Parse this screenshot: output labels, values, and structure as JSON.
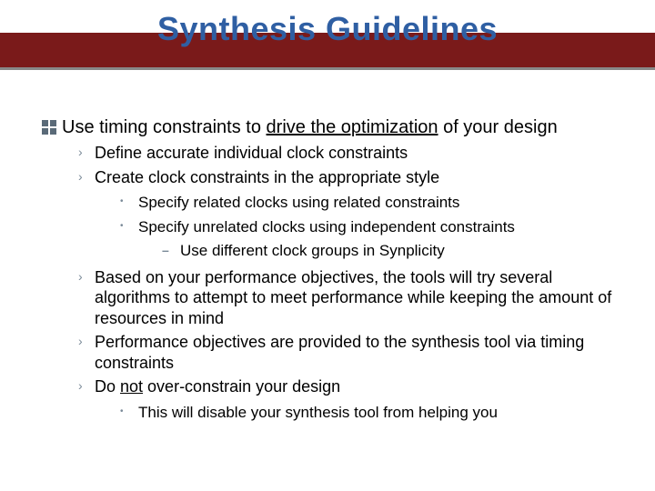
{
  "title": "Synthesis Guidelines",
  "bullets": {
    "main_pre": "Use timing constraints to ",
    "main_u": "drive the optimization",
    "main_post": " of your design",
    "sub1": "Define accurate individual clock constraints",
    "sub2": "Create clock constraints in the appropriate style",
    "sub2a": "Specify related clocks using related constraints",
    "sub2b": "Specify unrelated clocks using independent constraints",
    "sub2b1": "Use different clock groups in Synplicity",
    "sub3": "Based on your performance objectives, the tools will try several algorithms to attempt to meet performance while keeping the amount of resources in mind",
    "sub4": "Performance objectives are provided to the synthesis tool via timing constraints",
    "sub5_pre": "Do ",
    "sub5_u": "not",
    "sub5_post": " over-constrain your design",
    "sub5a": "This will disable your synthesis tool from helping you"
  }
}
